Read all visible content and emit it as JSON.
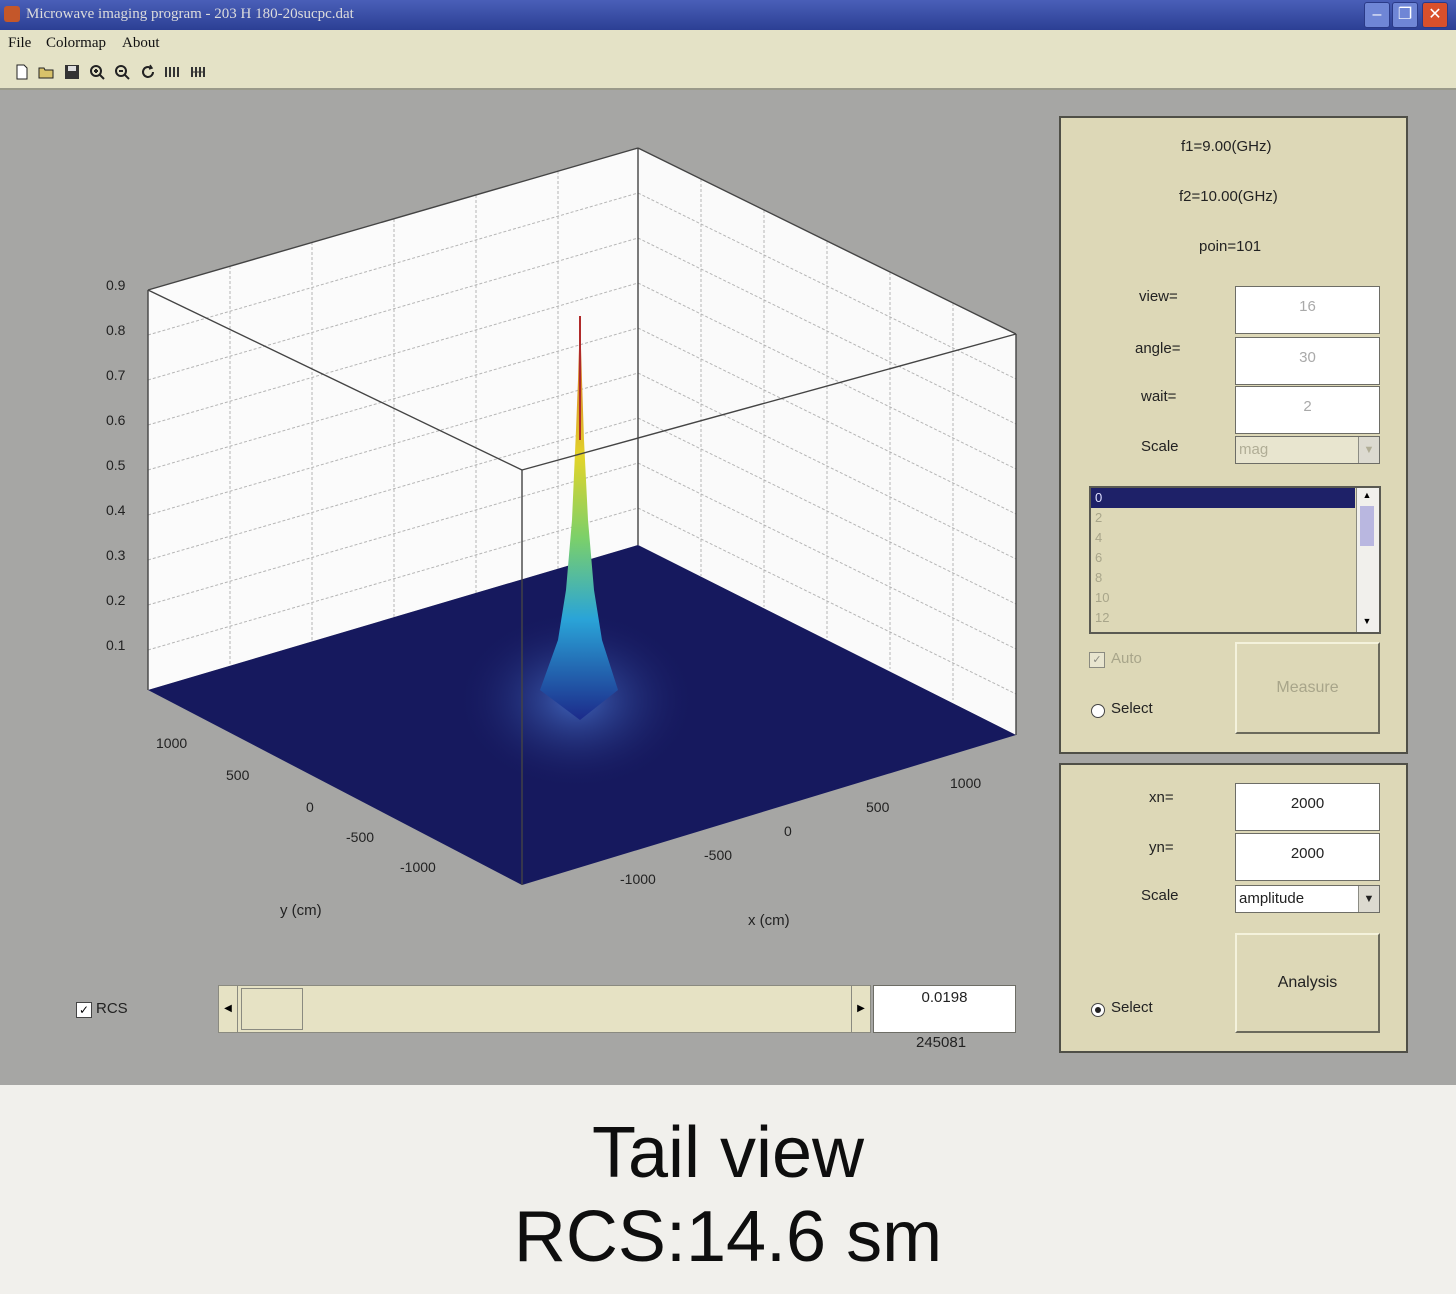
{
  "window": {
    "title": "Microwave imaging program - 203 H 180-20sucpc.dat",
    "menu": [
      "File",
      "Colormap",
      "About"
    ],
    "toolbar_icons": [
      "new-file-icon",
      "open-folder-icon",
      "save-icon",
      "zoom-in-icon",
      "zoom-out-icon",
      "rotate-icon",
      "data-tool-icon",
      "data-tool-2-icon"
    ]
  },
  "plot": {
    "z_ticks": [
      "0.9",
      "0.8",
      "0.7",
      "0.6",
      "0.5",
      "0.4",
      "0.3",
      "0.2",
      "0.1"
    ],
    "y_ticks": [
      "1000",
      "500",
      "0",
      "-500",
      "-1000"
    ],
    "x_ticks": [
      "1000",
      "500",
      "0",
      "-500",
      "-1000"
    ],
    "y_label": "y (cm)",
    "x_label": "x (cm)",
    "colors": {
      "floor": "#16195e",
      "wall": "#fbfbfb",
      "frame": "#6d6d6d"
    }
  },
  "info_panel": {
    "f1": "f1=9.00(GHz)",
    "f2": "f2=10.00(GHz)",
    "poin": "poin=101",
    "view_label": "view=",
    "view_value": "16",
    "angle_label": "angle=",
    "angle_value": "30",
    "wait_label": "wait=",
    "wait_value": "2",
    "scale_label": "Scale",
    "scale_value": "mag",
    "list_items": [
      "0",
      "2",
      "4",
      "6",
      "8",
      "10",
      "12"
    ],
    "auto_label": "Auto",
    "select_label": "Select",
    "measure_label": "Measure"
  },
  "analysis_panel": {
    "xn_label": "xn=",
    "xn_value": "2000",
    "yn_label": "yn=",
    "yn_value": "2000",
    "scale_label": "Scale",
    "scale_value": "amplitude",
    "select_label": "Select",
    "analysis_label": "Analysis"
  },
  "bottom": {
    "rcs_label": "RCS",
    "slider_value": "0.0198",
    "below_value": "245081"
  },
  "caption": {
    "line1": "Tail view",
    "line2": "RCS:14.6 sm"
  }
}
